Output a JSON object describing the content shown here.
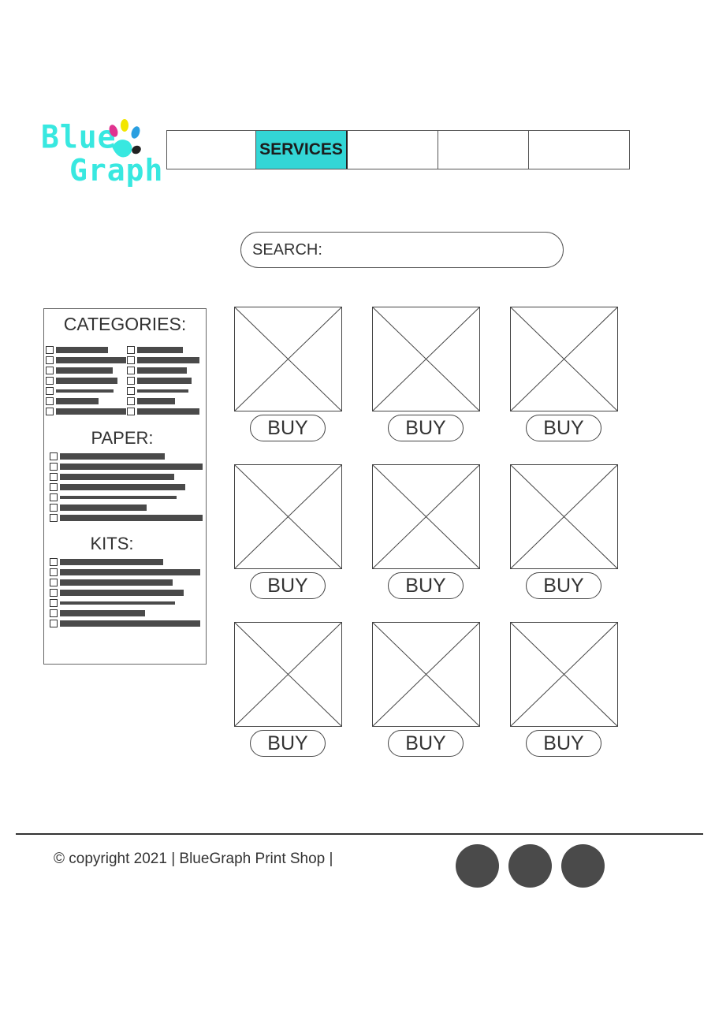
{
  "logo": {
    "line1": "Blue",
    "line2": "Graph",
    "colors": {
      "cyan": "#38e8e0",
      "magenta": "#e0338f",
      "yellow": "#f2e600",
      "black": "#222222"
    }
  },
  "nav": {
    "items": [
      {
        "label": "",
        "active": false
      },
      {
        "label": "SERVICES",
        "active": true
      },
      {
        "label": "",
        "active": false
      },
      {
        "label": "",
        "active": false
      },
      {
        "label": "",
        "active": false
      }
    ],
    "accent_color": "#33d6d6"
  },
  "search": {
    "label": "SEARCH:",
    "value": "",
    "placeholder": ""
  },
  "sidebar": {
    "categories_title": "CATEGORIES:",
    "paper_title": "PAPER:",
    "kits_title": "KITS:"
  },
  "products": {
    "buy_label": "BUY",
    "count": 9
  },
  "footer": {
    "copyright": "© copyright 2021 | BlueGraph Print Shop |",
    "social_icons": [
      "social-icon-1",
      "social-icon-2",
      "social-icon-3"
    ]
  }
}
